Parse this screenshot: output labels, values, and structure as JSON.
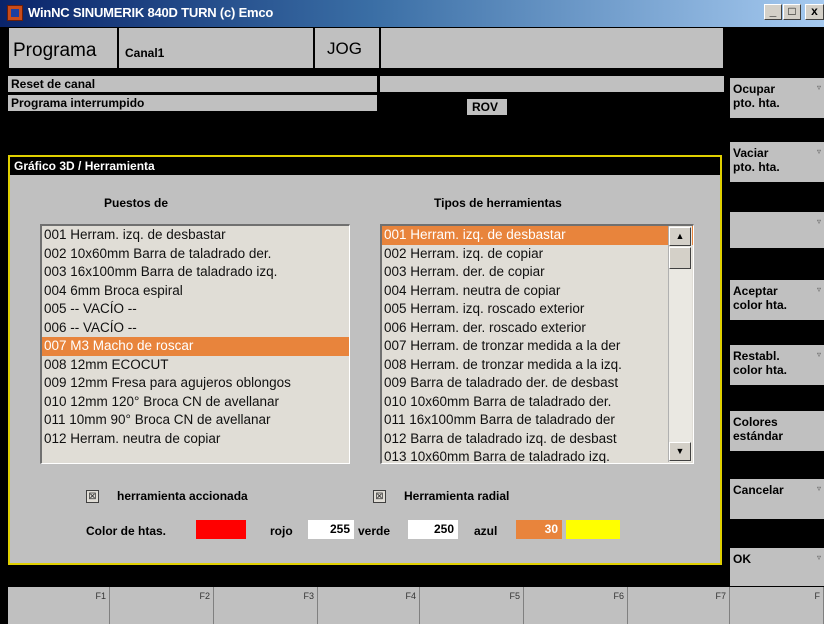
{
  "window": {
    "title": "WinNC SINUMERIK 840D TURN (c) Emco",
    "controls": {
      "minimize": "_",
      "maximize": "□",
      "close": "x"
    }
  },
  "header": {
    "program_label": "Programa",
    "channel": "Canal1",
    "mode": "JOG",
    "reset_status": "Reset de canal",
    "program_status": "Programa interrumpido",
    "rov": "ROV"
  },
  "dialog": {
    "title": "Gráfico 3D / Herramienta",
    "left_heading": "Puestos de",
    "right_heading": "Tipos de herramientas",
    "puestos": [
      "001 Herram. izq. de desbastar",
      "002 10x60mm Barra de taladrado der.",
      "003 16x100mm Barra de taladrado izq.",
      "004 6mm Broca espiral",
      "005 -- VACÍO --",
      "006 -- VACÍO --",
      "007 M3 Macho de roscar",
      "008 12mm ECOCUT",
      "009 12mm Fresa para agujeros oblongos",
      "010 12mm 120° Broca CN de avellanar",
      "011 10mm 90° Broca CN de avellanar",
      "012 Herram. neutra de copiar"
    ],
    "puestos_selected_index": 6,
    "tipos": [
      "001 Herram. izq. de desbastar",
      "002 Herram. izq. de copiar",
      "003 Herram. der. de copiar",
      "004 Herram. neutra de copiar",
      "005 Herram. izq. roscado exterior",
      "006 Herram. der. roscado exterior",
      "007 Herram. de tronzar medida a la der",
      "008 Herram. de tronzar medida a la izq.",
      "009 Barra de taladrado der. de desbast",
      "010 10x60mm Barra de taladrado der.",
      "011 16x100mm Barra de taladrado der",
      "012 Barra de taladrado izq. de desbast",
      "013 10x60mm Barra de taladrado izq."
    ],
    "tipos_selected_index": 0,
    "check_accionada_label": "herramienta accionada",
    "check_radial_label": "Herramienta radial",
    "check_mark": "⊠",
    "color_label": "Color de htas.",
    "rojo_label": "rojo",
    "rojo_value": "255",
    "verde_label": "verde",
    "verde_value": "250",
    "azul_label": "azul",
    "azul_value": "30",
    "colors": {
      "tool_color": "#ff0000",
      "result_color": "#ffff00",
      "highlight": "#e8843c",
      "border": "#e0d000"
    }
  },
  "softkeys_right": [
    {
      "label": "Ocupar\npto. hta.",
      "mark": "▿"
    },
    {
      "label": "Vaciar\npto. hta.",
      "mark": "▿"
    },
    {
      "label": "",
      "mark": "▿"
    },
    {
      "label": "Aceptar\ncolor hta.",
      "mark": "▿"
    },
    {
      "label": "Restabl.\ncolor hta.",
      "mark": "▿"
    },
    {
      "label": "Colores\nestándar",
      "mark": ""
    },
    {
      "label": "Cancelar",
      "mark": "▿"
    },
    {
      "label": "OK",
      "mark": "▿"
    }
  ],
  "softkeys_bottom": [
    "F1",
    "F2",
    "F3",
    "F4",
    "F5",
    "F6",
    "F7",
    "F"
  ]
}
